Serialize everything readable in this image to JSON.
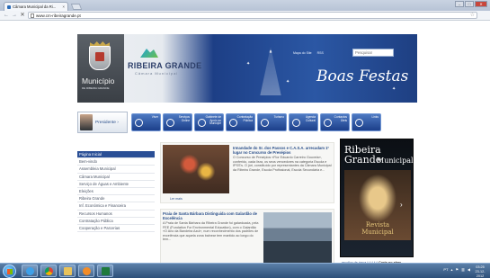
{
  "browser": {
    "tab_title": "Câmara Municipal da Ri...",
    "tab_close": "×",
    "url": "www.cm-ribeiragrande.pt",
    "back": "←",
    "forward": "→",
    "stop": "✕",
    "window_minimize": "–",
    "window_maximize": "□",
    "window_close": "✕"
  },
  "header": {
    "municipio": "Município",
    "municipio_sub": "DE RIBEIRA GRANDE",
    "brand": "RIBEIRA GRANDE",
    "brand_sub": "Câmara Municipal",
    "search_placeholder": "Pesquisar",
    "link_1": "Mapa do Site",
    "link_2": "RSS",
    "greeting": "Boas Festas"
  },
  "navbar": {
    "mayor_label": "Presidente ›",
    "items": [
      {
        "label": "Viver"
      },
      {
        "label": "Serviços Online"
      },
      {
        "label": "Gabinete de Apoio ao Munícipe"
      },
      {
        "label": "Contratação Pública"
      },
      {
        "label": "Turismo"
      },
      {
        "label": "Agenda Cultural"
      },
      {
        "label": "Contactos Úteis"
      },
      {
        "label": "Links"
      }
    ]
  },
  "menu": {
    "items": [
      {
        "label": "Página Inicial",
        "active": true
      },
      {
        "label": "Bem-vindo"
      },
      {
        "label": "Assembleia Municipal"
      },
      {
        "label": "Câmara Municipal"
      },
      {
        "label": "Serviço de Águas e Ambiente"
      },
      {
        "label": "Eleições"
      },
      {
        "label": "Ribeira Grande"
      },
      {
        "label": "Inf. Económica e Financeira"
      },
      {
        "label": "Recursos Humanos"
      },
      {
        "label": "Contratação Pública"
      },
      {
        "label": "Cooperação e Parcerias"
      }
    ]
  },
  "news": {
    "item1_title": "Irmandade do Sr. dos Passos e C.A.S.A. arrecadam 1º lugar no Concurso de Presépios",
    "item1_text": "O Concurso de Presépios «Flor Eduardo Carreiro Gouveia», conferido, cada lisra, os seus vencedores na categoria Escola e IPSS's. O júri, constituído por representantes da Câmara Municipal da Ribeira Grande, Escola Profissional, Escola Secundária e...",
    "item1_more": "Ler mais",
    "item2_title": "Praia de Santa Bárbara Distinguida com Galardão de Excelência",
    "item2_text": "A Praia de Santa Bárbara da Ribeira Grande foi galardoada, pela FEE (Fundation For Environmental Education), com o Galardão «O Ano da Bandeira Azul», num reconhecimento dos padrões de excelência que aquela zona balnear tem mantido ao longo do tem..."
  },
  "banner": {
    "title": "Ribeira Grande",
    "subtitle": "Municipal",
    "revista": "Revista Municipal",
    "arrow": "›",
    "ticker_prefix": "recolha de água",
    "ticker_sep": " * * * * * ",
    "ticker_text": "Corte no abas"
  },
  "taskbar": {
    "tray_lang": "PT",
    "time": "03:25",
    "date": "23-12-2012"
  }
}
